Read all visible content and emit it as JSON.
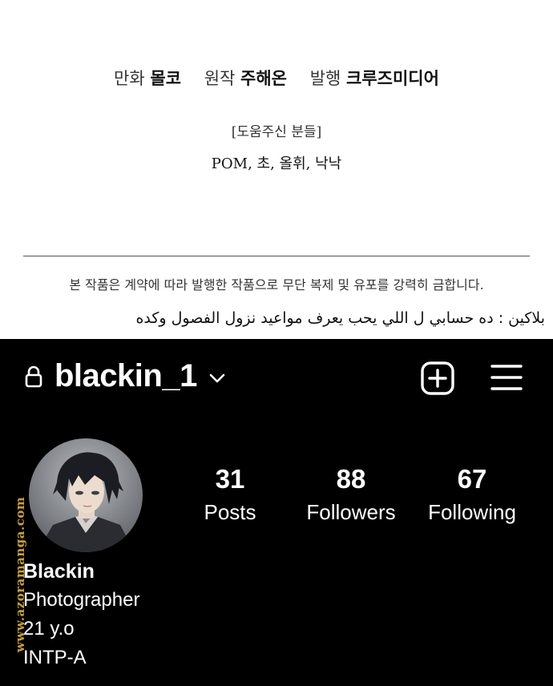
{
  "credits": {
    "manhwa_label": "만화",
    "manhwa_name": "몰코",
    "original_label": "원작",
    "original_name": "주해온",
    "publisher_label": "발행",
    "publisher_name": "크루즈미디어",
    "helpers_title": "[도움주신 분들]",
    "helpers_names": "POM, 초, 올휘, 낙낙",
    "copyright": "본 작품은 계약에 따라 발행한 작품으로 무단 복제 및 유포를 강력히 금합니다."
  },
  "translator_note": "بلاكين : ده حسابي ل اللي يحب يعرف مواعيد نزول الفصول وكده",
  "profile": {
    "username": "blackin_1",
    "stats": {
      "posts_count": "31",
      "posts_label": "Posts",
      "followers_count": "88",
      "followers_label": "Followers",
      "following_count": "67",
      "following_label": "Following"
    },
    "bio": {
      "name": "Blackin",
      "line1": "Photographer",
      "line2": "21 y.o",
      "line3": "INTP-A"
    }
  },
  "watermark": "www.azoramanga.com",
  "colors": {
    "ig_background": "#000000",
    "ig_text": "#ffffff",
    "watermark": "#c9a227"
  },
  "icons": [
    "lock-icon",
    "chevron-down-icon",
    "add-post-icon",
    "menu-icon"
  ]
}
